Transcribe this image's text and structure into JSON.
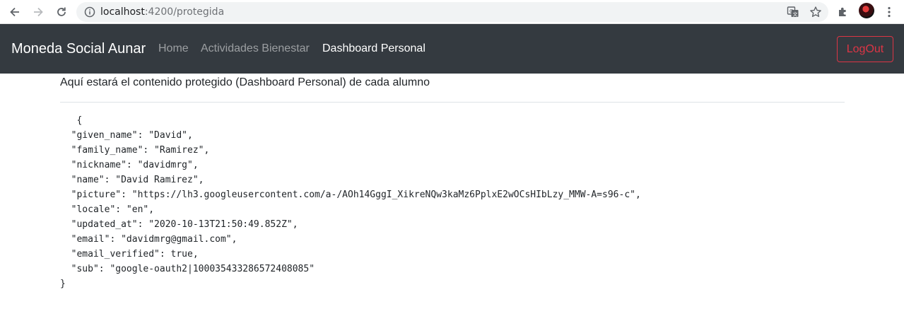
{
  "browser": {
    "url_host": "localhost",
    "url_path": ":4200/protegida"
  },
  "navbar": {
    "brand": "Moneda Social Aunar",
    "links": [
      {
        "label": "Home",
        "active": false
      },
      {
        "label": "Actividades Bienestar",
        "active": false
      },
      {
        "label": "Dashboard Personal",
        "active": true
      }
    ],
    "logout_label": "LogOut"
  },
  "content": {
    "intro": "Aquí estará el contenido protegido (Dashboard Personal) de cada alumno",
    "json_lines": [
      "   {",
      "  \"given_name\": \"David\",",
      "  \"family_name\": \"Ramirez\",",
      "  \"nickname\": \"davidmrg\",",
      "  \"name\": \"David Ramirez\",",
      "  \"picture\": \"https://lh3.googleusercontent.com/a-/AOh14GggI_XikreNQw3kaMz6PplxE2wOCsHIbLzy_MMW-A=s96-c\",",
      "  \"locale\": \"en\",",
      "  \"updated_at\": \"2020-10-13T21:50:49.852Z\",",
      "  \"email\": \"davidmrg@gmail.com\",",
      "  \"email_verified\": true,",
      "  \"sub\": \"google-oauth2|100035433286572408085\"",
      "}"
    ]
  },
  "icons": {
    "back": "back-arrow-icon",
    "forward": "forward-arrow-icon",
    "reload": "reload-icon",
    "site_info": "info-icon",
    "translate": "translate-icon",
    "bookmark": "star-icon",
    "extensions": "puzzle-icon",
    "menu": "kebab-menu-icon"
  },
  "colors": {
    "navbar_bg": "#343a40",
    "logout": "#dc3545"
  }
}
